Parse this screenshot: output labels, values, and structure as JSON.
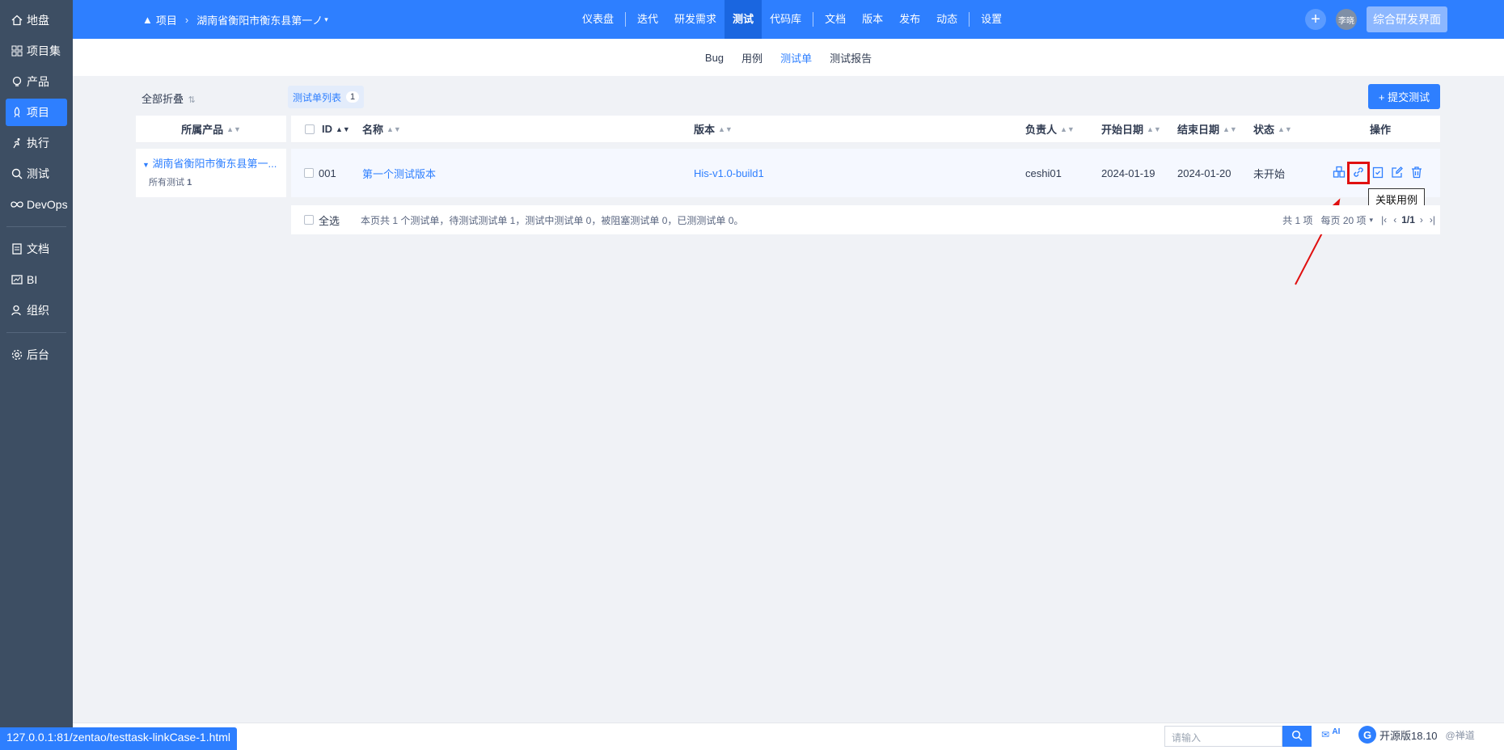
{
  "rail": {
    "items": [
      {
        "label": "地盘",
        "icon": "home-icon"
      },
      {
        "label": "项目集",
        "icon": "grid-icon"
      },
      {
        "label": "产品",
        "icon": "bulb-icon"
      },
      {
        "label": "项目",
        "icon": "rocket-icon"
      },
      {
        "label": "执行",
        "icon": "run-icon"
      },
      {
        "label": "测试",
        "icon": "magnifier-icon"
      },
      {
        "label": "DevOps",
        "icon": "infinity-icon"
      },
      {
        "label": "文档",
        "icon": "doc-icon"
      },
      {
        "label": "BI",
        "icon": "chart-icon"
      },
      {
        "label": "组织",
        "icon": "people-icon"
      },
      {
        "label": "后台",
        "icon": "gear-icon"
      }
    ]
  },
  "topbar": {
    "crumb_root": "项目",
    "crumb_project": "湖南省衡阳市衡东县第一ノ",
    "nav": [
      "仪表盘",
      "迭代",
      "研发需求",
      "测试",
      "代码库",
      "文档",
      "版本",
      "发布",
      "动态",
      "设置"
    ],
    "avatar": "李晓",
    "ui_switch": "综合研发界面"
  },
  "subnav": [
    "Bug",
    "用例",
    "测试单",
    "测试报告"
  ],
  "tree": {
    "fold_label": "全部折叠",
    "header": "所属产品",
    "node": "湖南省衡阳市衡东县第一...",
    "sub_label": "所有测试",
    "sub_count": "1"
  },
  "list": {
    "tab_label": "测试单列表",
    "tab_count": "1",
    "submit_label": "+ 提交测试",
    "columns": {
      "id": "ID",
      "name": "名称",
      "build": "版本",
      "owner": "负责人",
      "start": "开始日期",
      "end": "结束日期",
      "status": "状态",
      "actions": "操作"
    },
    "rows": [
      {
        "id": "001",
        "name": "第一个测试版本",
        "build": "His-v1.0-build1",
        "owner": "ceshi01",
        "start": "2024-01-19",
        "end": "2024-01-20",
        "status": "未开始"
      }
    ],
    "tooltip": "关联用例",
    "select_all": "全选",
    "summary": "本页共 1 个测试单，待测试测试单 1，测试中测试单 0，被阻塞测试单 0，已测测试单 0。",
    "pager": {
      "total": "共 1 项",
      "per_page": "每页 20 项",
      "page": "1/1"
    }
  },
  "bottom": {
    "status_url": "127.0.0.1:81/zentao/testtask-linkCase-1.html",
    "search_placeholder": "请输入",
    "ai_label": "AI",
    "version": "开源版18.10",
    "sub": "@禅道"
  },
  "colors": {
    "accent": "#2e7fff",
    "rail": "#3d4e63",
    "highlight": "#e01010"
  }
}
